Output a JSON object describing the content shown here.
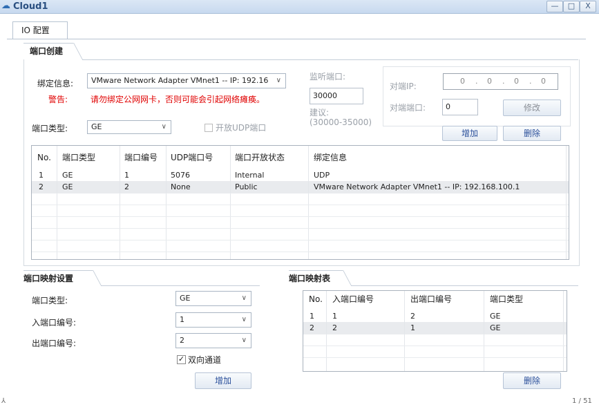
{
  "window": {
    "title": "Cloud1",
    "minimize": "—",
    "maximize": "□",
    "close": "X"
  },
  "tabs": [
    {
      "label": "IO 配置"
    }
  ],
  "port_create": {
    "heading": "端口创建",
    "bind_label": "绑定信息:",
    "bind_value": "VMware Network Adapter VMnet1 -- IP: 192.16",
    "warn_label": "警告:",
    "warn_text": "请勿绑定公网网卡，否则可能会引起网络瘫痪。",
    "port_type_label": "端口类型:",
    "port_type_value": "GE",
    "udp_checkbox_label": "开放UDP端口",
    "listen_label": "监听端口:",
    "listen_value": "30000",
    "suggest_label": "建议:",
    "suggest_range": "(30000-35000)",
    "peer_ip_label": "对端IP:",
    "peer_ip": [
      "0",
      "0",
      "0",
      "0"
    ],
    "peer_port_label": "对端端口:",
    "peer_port_value": "0",
    "modify_button": "修改",
    "add_button": "增加",
    "delete_button": "删除",
    "table": {
      "headers": [
        "No.",
        "端口类型",
        "端口编号",
        "UDP端口号",
        "端口开放状态",
        "绑定信息"
      ],
      "rows": [
        [
          "1",
          "GE",
          "1",
          "5076",
          "Internal",
          "UDP"
        ],
        [
          "2",
          "GE",
          "2",
          "None",
          "Public",
          "VMware Network Adapter VMnet1 -- IP: 192.168.100.1"
        ]
      ]
    }
  },
  "port_mapping_settings": {
    "heading": "端口映射设置",
    "port_type_label": "端口类型:",
    "port_type_value": "GE",
    "in_port_label": "入端口编号:",
    "in_port_value": "1",
    "out_port_label": "出端口编号:",
    "out_port_value": "2",
    "bidirectional_label": "双向通道",
    "bidirectional_checked": true,
    "add_button": "增加"
  },
  "port_mapping_table": {
    "heading": "端口映射表",
    "headers": [
      "No.",
      "入端口编号",
      "出端口编号",
      "端口类型"
    ],
    "rows": [
      [
        "1",
        "1",
        "2",
        "GE"
      ],
      [
        "2",
        "2",
        "1",
        "GE"
      ]
    ],
    "delete_button": "删除"
  },
  "footer": {
    "left": "⅄",
    "right": "1 / 51"
  },
  "colors": {
    "warning": "#e00000",
    "accent": "#2a4f9a"
  }
}
